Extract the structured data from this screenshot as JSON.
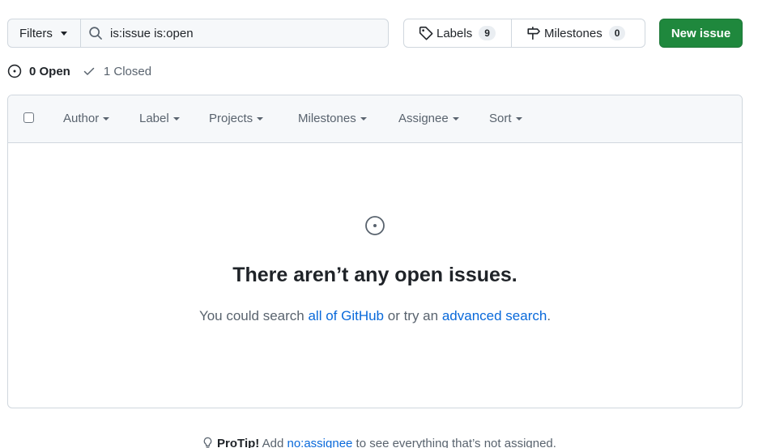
{
  "toolbar": {
    "filters_label": "Filters",
    "search_value": "is:issue is:open",
    "labels_label": "Labels",
    "labels_count": "9",
    "milestones_label": "Milestones",
    "milestones_count": "0",
    "new_issue_label": "New issue"
  },
  "states": {
    "open_label": "0 Open",
    "closed_label": "1 Closed"
  },
  "header_menus": [
    {
      "label": "Author"
    },
    {
      "label": "Label"
    },
    {
      "label": "Projects"
    },
    {
      "label": "Milestones"
    },
    {
      "label": "Assignee"
    },
    {
      "label": "Sort"
    }
  ],
  "blankslate": {
    "title": "There aren’t any open issues.",
    "desc_prefix": "You could search ",
    "link1": "all of GitHub",
    "desc_middle": " or try an ",
    "link2": "advanced search",
    "desc_suffix": "."
  },
  "protip": {
    "label": "ProTip!",
    "prefix": " Add ",
    "link": "no:assignee",
    "suffix": " to see everything that’s not assigned."
  },
  "colors": {
    "primary_button": "#1f883d",
    "link": "#0969da",
    "border": "#d0d7de",
    "header_bg": "#f6f8fa"
  },
  "icons": {
    "search": "search-icon",
    "tag": "tag-icon",
    "milestone": "milestone-icon",
    "issue_open": "issue-opened-icon",
    "check": "check-icon",
    "light_bulb": "light-bulb-icon"
  }
}
